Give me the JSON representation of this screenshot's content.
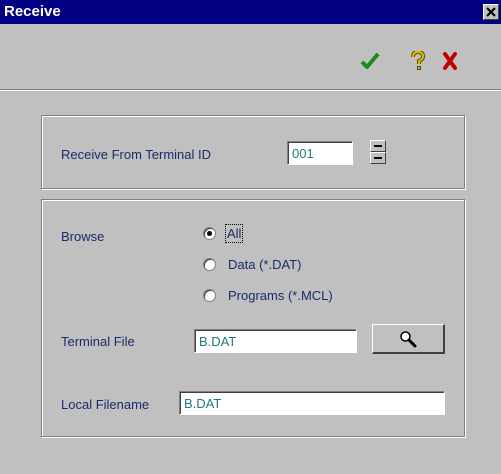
{
  "window": {
    "title": "Receive"
  },
  "toolbar": {
    "ok": {
      "icon": "check-icon",
      "color": "#1e8a1e"
    },
    "help": {
      "icon": "question-icon",
      "color": "#c8a800"
    },
    "cancel": {
      "icon": "x-icon",
      "color": "#c00000"
    }
  },
  "terminal": {
    "label": "Receive From Terminal ID",
    "value": "001"
  },
  "browse": {
    "label": "Browse",
    "options": [
      {
        "label": "All",
        "selected": true
      },
      {
        "label": "Data (*.DAT)",
        "selected": false
      },
      {
        "label": "Programs (*.MCL)",
        "selected": false
      }
    ]
  },
  "terminal_file": {
    "label": "Terminal File",
    "value": "B.DAT"
  },
  "local_filename": {
    "label": "Local Filename",
    "value": "B.DAT"
  }
}
